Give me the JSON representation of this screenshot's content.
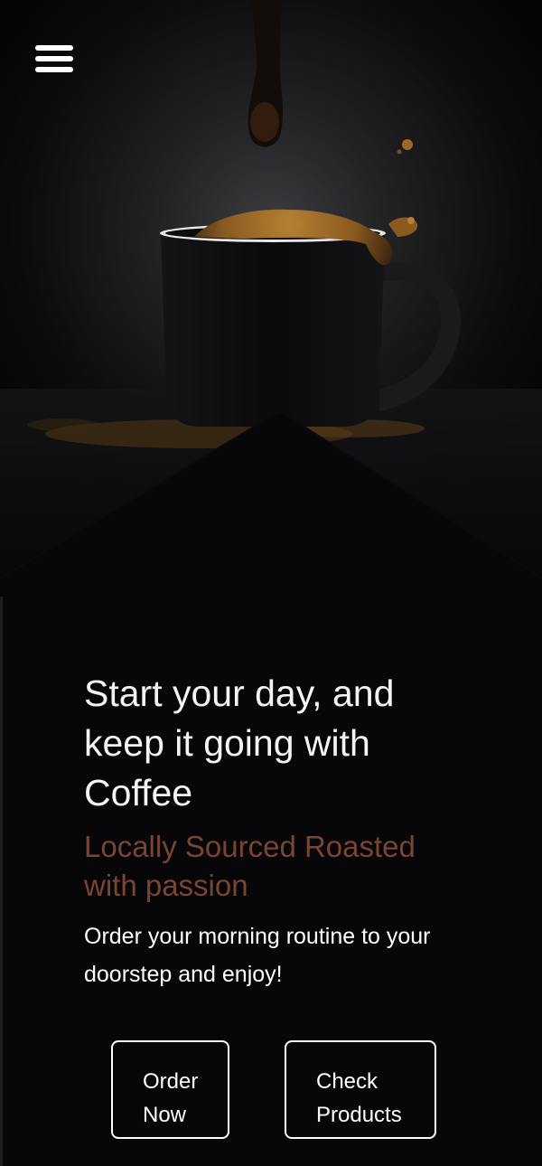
{
  "nav": {
    "menu_icon": "hamburger-menu-icon"
  },
  "hero": {
    "image": "coffee-cup-splash-photo"
  },
  "main": {
    "headline_lines": [
      "Start your day, and",
      "keep it going with",
      "Coffee"
    ],
    "tagline_lines": [
      "Locally Sourced Roasted",
      "with passion"
    ],
    "description_lines": [
      "Order your morning routine to your",
      "doorstep and enjoy!"
    ]
  },
  "actions": {
    "order_button": [
      "Order",
      "Now"
    ],
    "check_button": [
      "Check",
      "Products"
    ]
  },
  "colors": {
    "background": "#070709",
    "tagline": "#7a4530",
    "text": "#ffffff",
    "coffee_foam": "#9a6a25"
  }
}
